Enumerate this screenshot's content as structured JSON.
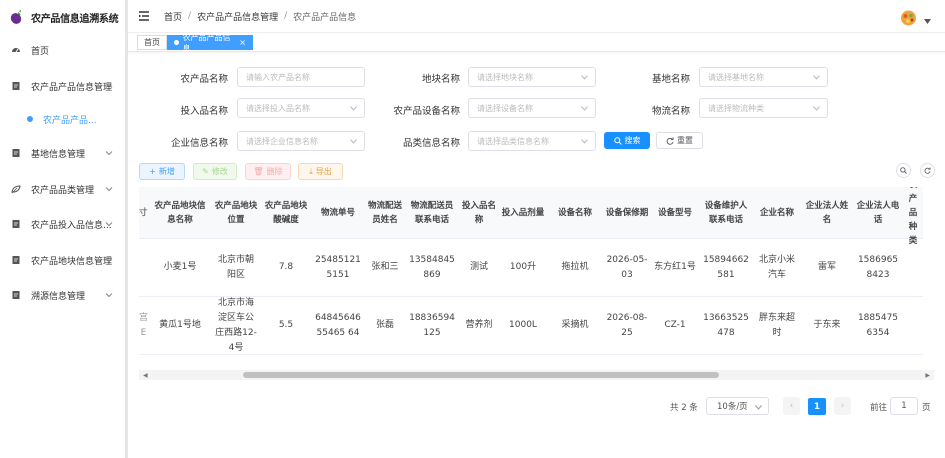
{
  "app": {
    "title": "农产品信息追溯系统"
  },
  "sidebar": {
    "items": [
      {
        "label": "首页",
        "icon": "dashboard-icon"
      },
      {
        "label": "农产品产品信息管理",
        "icon": "document-icon"
      },
      {
        "label": "农产品产品...",
        "icon": "dot-icon",
        "active": true
      },
      {
        "label": "基地信息管理",
        "icon": "document-icon"
      },
      {
        "label": "农产品品类管理",
        "icon": "leaf-icon"
      },
      {
        "label": "农产品投入品信息...",
        "icon": "document-icon"
      },
      {
        "label": "农产品地块信息管理",
        "icon": "document-icon"
      },
      {
        "label": "溯源信息管理",
        "icon": "document-icon"
      }
    ]
  },
  "breadcrumb": [
    "首页",
    "农产品产品信息管理",
    "农产品产品信息"
  ],
  "tags": [
    {
      "label": "首页"
    },
    {
      "label": "农产品产品信息"
    }
  ],
  "search": {
    "fields": [
      {
        "label": "农产品名称",
        "placeholder": "请输入农产品名称"
      },
      {
        "label": "地块名称",
        "placeholder": "请选择地块名称"
      },
      {
        "label": "基地名称",
        "placeholder": "请选择基地名称"
      },
      {
        "label": "投入品名称",
        "placeholder": "请选择投入品名称"
      },
      {
        "label": "农产品设备名称",
        "placeholder": "请选择设备名称"
      },
      {
        "label": "物流名称",
        "placeholder": "请选择物流种类"
      },
      {
        "label": "企业信息名称",
        "placeholder": "请选择企业信息名称"
      },
      {
        "label": "品类信息名称",
        "placeholder": "请选择品类信息名称"
      }
    ],
    "search_label": "搜索",
    "reset_label": "重置"
  },
  "toolbar": {
    "add": "新增",
    "edit": "修改",
    "delete": "删除",
    "export": "导出"
  },
  "colors": {
    "primary": "#1890ff",
    "sidebar_active": "#409eff"
  },
  "table": {
    "columns": [
      "农产品地块信息名称",
      "农产品地块位置",
      "农产品地块酸碱度",
      "物流单号",
      "物流配送员姓名",
      "物流配送员联系电话",
      "投入品名称",
      "投入品剂量",
      "设备名称",
      "设备保修期",
      "设备型号",
      "设备维护人联系电话",
      "企业名称",
      "企业法人姓名",
      "企业法人电话",
      "农产品种类"
    ],
    "rows": [
      [
        "小麦1号",
        "北京市朝阳区",
        "7.8",
        "254851215151",
        "张和三",
        "13584845869",
        "测试",
        "100升",
        "拖拉机",
        "2026-05-03",
        "东方红1号",
        "15894662581",
        "北京小米汽车",
        "雷军",
        "15869658423",
        ""
      ],
      [
        "黄瓜1号地",
        "北京市海淀区车公庄西路12-4号",
        "5.5",
        "6484564655465 64",
        "张磊",
        "18836594125",
        "营养剂",
        "1000L",
        "采摘机",
        "2026-08-25",
        "CZ-1",
        "13663525478",
        "胖东来超时",
        "于东来",
        "18854756354",
        ""
      ]
    ]
  },
  "pagination": {
    "total": "共 2 条",
    "page_size": "10条/页",
    "current": "1",
    "goto_label": "前往",
    "goto_value": "1",
    "page_suffix": "页"
  }
}
